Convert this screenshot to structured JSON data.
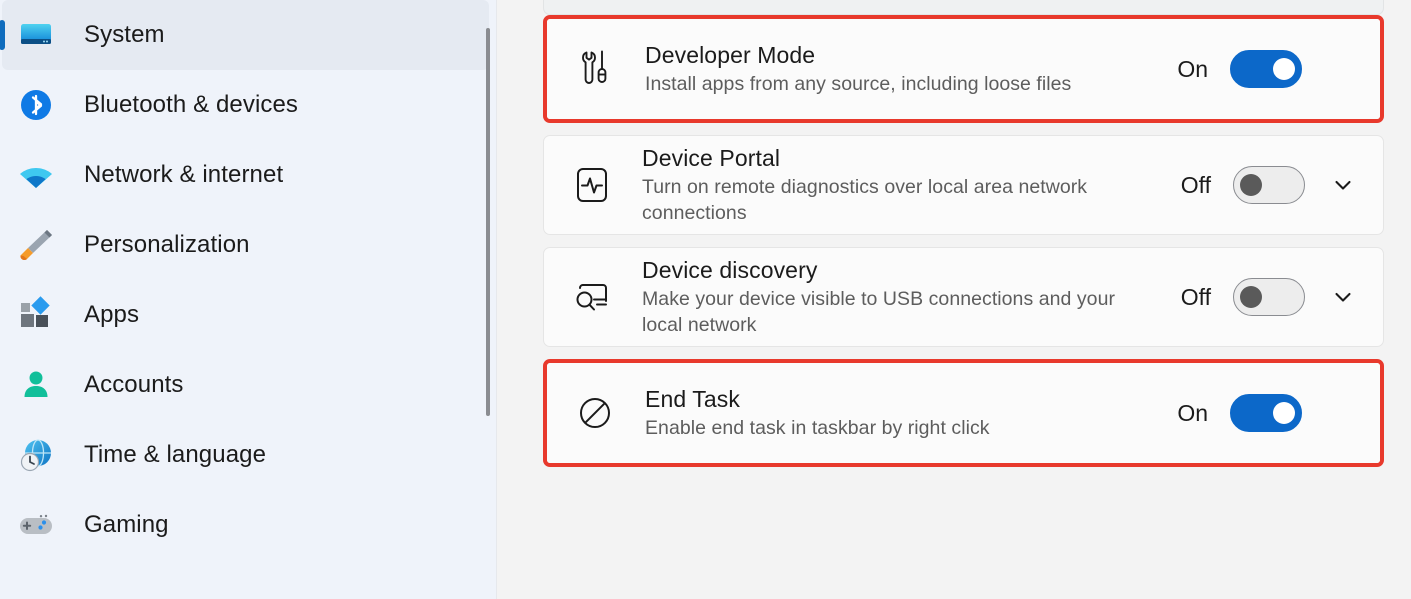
{
  "sidebar": {
    "items": [
      {
        "label": "System",
        "icon": "monitor-icon",
        "selected": true
      },
      {
        "label": "Bluetooth & devices",
        "icon": "bluetooth-icon",
        "selected": false
      },
      {
        "label": "Network & internet",
        "icon": "wifi-icon",
        "selected": false
      },
      {
        "label": "Personalization",
        "icon": "paintbrush-icon",
        "selected": false
      },
      {
        "label": "Apps",
        "icon": "apps-icon",
        "selected": false
      },
      {
        "label": "Accounts",
        "icon": "person-icon",
        "selected": false
      },
      {
        "label": "Time & language",
        "icon": "clock-globe-icon",
        "selected": false
      },
      {
        "label": "Gaming",
        "icon": "gamepad-icon",
        "selected": false
      }
    ]
  },
  "main": {
    "settings": [
      {
        "title": "Developer Mode",
        "description": "Install apps from any source, including loose files",
        "state": "On",
        "toggle_on": true,
        "icon": "tools-icon",
        "has_chevron": false,
        "highlighted": true
      },
      {
        "title": "Device Portal",
        "description": "Turn on remote diagnostics over local area network connections",
        "state": "Off",
        "toggle_on": false,
        "icon": "pulse-icon",
        "has_chevron": true,
        "highlighted": false
      },
      {
        "title": "Device discovery",
        "description": "Make your device visible to USB connections and your local network",
        "state": "Off",
        "toggle_on": false,
        "icon": "device-search-icon",
        "has_chevron": true,
        "highlighted": false
      },
      {
        "title": "End Task",
        "description": "Enable end task in taskbar by right click",
        "state": "On",
        "toggle_on": true,
        "icon": "prohibited-icon",
        "has_chevron": false,
        "highlighted": true
      }
    ]
  },
  "colors": {
    "highlight_border": "#E8392C",
    "accent_blue": "#0C68C9",
    "selection_pill": "#0F6CBD",
    "sidebar_bg": "#EFF3FA",
    "content_bg": "#F3F3F3",
    "card_bg": "#FBFBFB"
  }
}
